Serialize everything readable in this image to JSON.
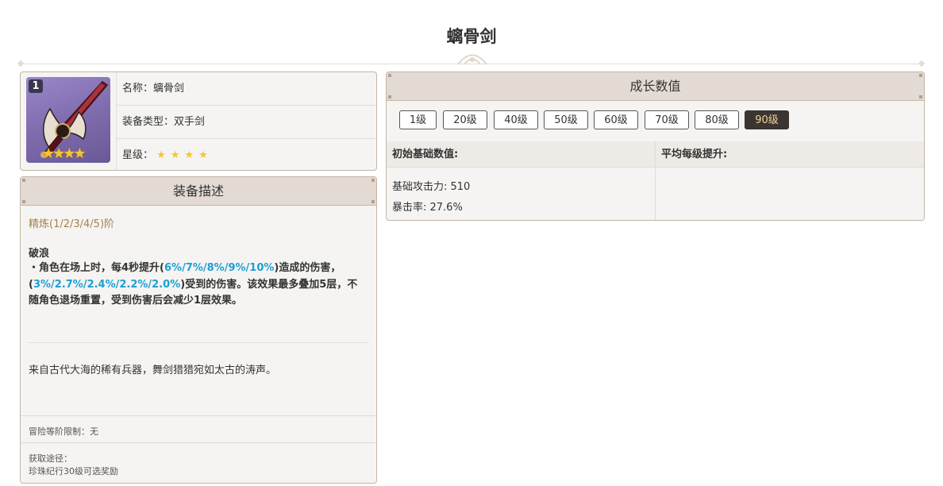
{
  "page": {
    "title": "螭骨剑"
  },
  "weapon": {
    "rank_badge": "1",
    "name_label": "名称：",
    "name_value": "螭骨剑",
    "type_label": "装备类型：",
    "type_value": "双手剑",
    "rarity_label": "星级：",
    "rarity_stars": 4,
    "star_glyph": "★"
  },
  "description": {
    "header": "装备描述",
    "refine": "精炼(1/2/3/4/5)阶",
    "skill_name": "破浪",
    "skill_parts": [
      {
        "text": "・角色在场上时，每4秒提升(",
        "hl": false
      },
      {
        "text": "6%/7%/8%/9%/10%",
        "hl": true
      },
      {
        "text": ")造成的伤害，(",
        "hl": false
      },
      {
        "text": "3%/2.7%/2.4%/2.2%/2.0%",
        "hl": true
      },
      {
        "text": ")受到的伤害。该效果最多叠加5层，不随角色退场重置，受到伤害后会减少1层效果。",
        "hl": false
      }
    ],
    "flavor": "来自古代大海的稀有兵器，舞剑猎猎宛如太古的涛声。",
    "ascension_limit": "冒险等阶限制：无",
    "source_label": "获取途径：",
    "source_value": "珍珠纪行30级可选奖励"
  },
  "growth": {
    "header": "成长数值",
    "levels": [
      "1级",
      "20级",
      "40级",
      "50级",
      "60级",
      "70级",
      "80级",
      "90级"
    ],
    "active_level": "90级",
    "base_header": "初始基础数值:",
    "avg_header": "平均每级提升:",
    "base_stats": [
      "基础攻击力: 510",
      "暴击率: 27.6%"
    ]
  },
  "colors": {
    "highlight": "#1c9fd5",
    "refine_text": "#a5824c",
    "star": "#f5c43a",
    "active_button_bg": "#3a3530",
    "active_button_text": "#f0d49a"
  }
}
